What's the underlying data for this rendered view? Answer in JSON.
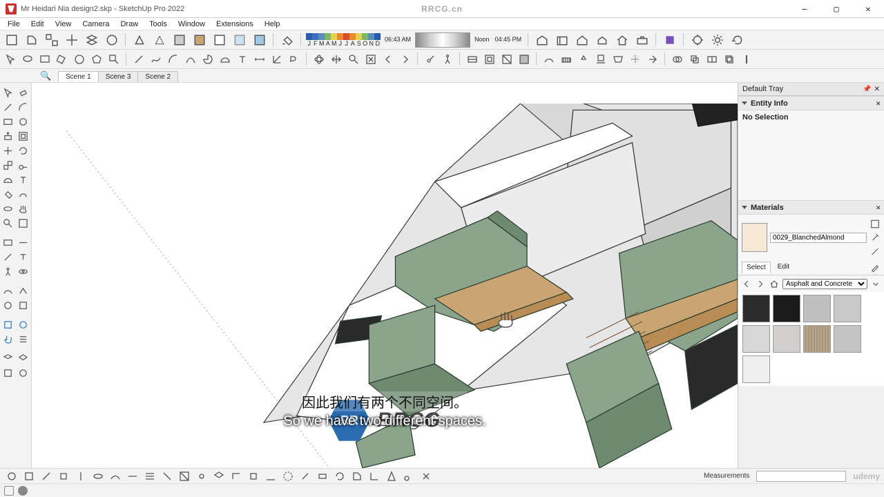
{
  "window": {
    "title": "Mr Heidari Nia design2.skp - SketchUp Pro 2022",
    "center_brand": "RRCG.cn",
    "btn_min": "—",
    "btn_max": "▢",
    "btn_close": "✕"
  },
  "menu": [
    "File",
    "Edit",
    "View",
    "Camera",
    "Draw",
    "Tools",
    "Window",
    "Extensions",
    "Help"
  ],
  "time": {
    "months_band": [
      "J",
      "F",
      "M",
      "A",
      "M",
      "J",
      "J",
      "A",
      "S",
      "O",
      "N",
      "D"
    ],
    "t_left": "06:43 AM",
    "t_mid": "Noon",
    "t_right": "04:45 PM"
  },
  "scenes": {
    "search_icon": "🔍",
    "tabs": [
      "Scene 1",
      "Scene 3",
      "Scene 2"
    ],
    "active": 0
  },
  "tray": {
    "title": "Default Tray",
    "pin": "📌",
    "close": "✕",
    "entity_info_title": "Entity Info",
    "no_selection": "No Selection",
    "materials_title": "Materials",
    "mat_name": "0029_BlanchedAlmond",
    "select_tab": "Select",
    "edit_tab": "Edit",
    "library": "Asphalt and Concrete",
    "thumb_colors": [
      "#2c2c2c",
      "#1b1b1b",
      "#bfbfbf",
      "#c9c9c9",
      "#d7d7d7",
      "#d0cfcd",
      "#b9a88e",
      "#c4c4c4",
      "#efefef"
    ]
  },
  "bottom": {
    "measurements_label": "Measurements",
    "udemy": "udemy"
  },
  "overlay": {
    "brand": "RRCG",
    "hex_text": "RR",
    "sub_cn": "因此我们有两个不同空间。",
    "sub_en": "So we have two different spaces."
  },
  "colors": {
    "wood": "#c9a573",
    "wood2": "#b98c55",
    "cabinet": "#8aa58c",
    "cabinet_dk": "#6e8a71",
    "wall": "#e6e6e6",
    "floor": "#ffffff",
    "outline": "#333333",
    "dark_appliance": "#3a3a3a"
  }
}
